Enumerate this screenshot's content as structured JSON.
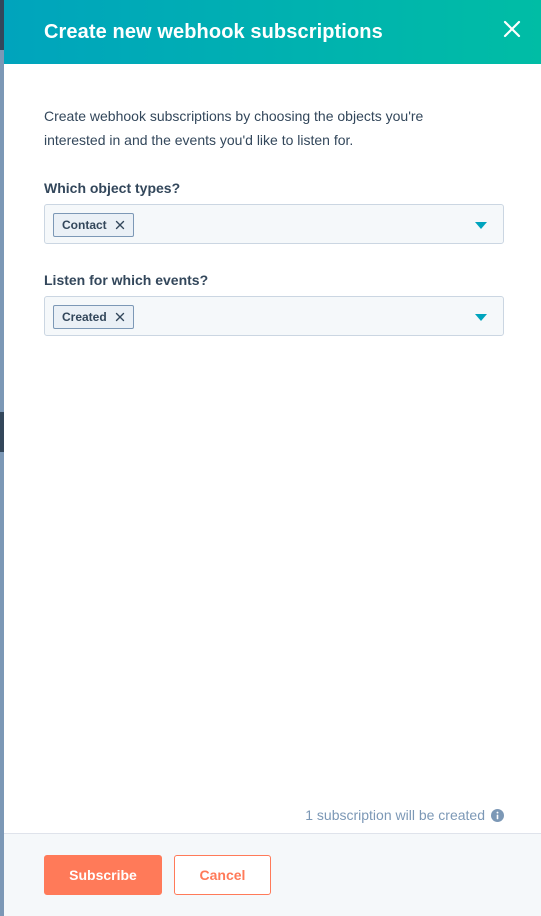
{
  "modal": {
    "title": "Create new webhook subscriptions",
    "close_icon": "close-icon",
    "description": "Create webhook subscriptions by choosing the objects you're interested in and the events you'd like to listen for."
  },
  "object_types": {
    "label": "Which object types?",
    "selected": [
      "Contact"
    ],
    "remove_icon": "x-icon",
    "dropdown_icon": "caret-down-icon"
  },
  "events": {
    "label": "Listen for which events?",
    "selected": [
      "Created"
    ],
    "remove_icon": "x-icon",
    "dropdown_icon": "caret-down-icon"
  },
  "summary": {
    "text": "1 subscription will be created",
    "icon": "info-icon"
  },
  "footer": {
    "subscribe_label": "Subscribe",
    "cancel_label": "Cancel"
  },
  "colors": {
    "header_start": "#00a4bd",
    "header_end": "#00bda5",
    "primary": "#ff7a59",
    "text": "#33475b",
    "muted": "#7c98b6",
    "accent_caret": "#00a4bd"
  }
}
